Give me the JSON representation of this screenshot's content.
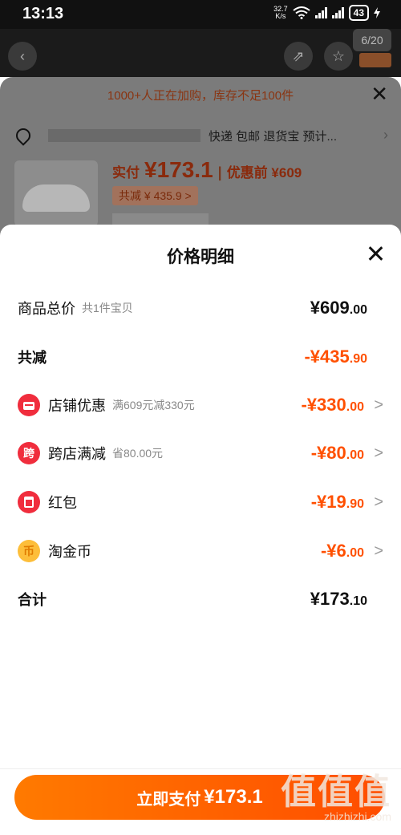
{
  "status_bar": {
    "time": "13:13",
    "net_speed_top": "32.7",
    "net_speed_bottom": "K/s",
    "battery": "43"
  },
  "background": {
    "page_count": "6/20",
    "banner": "1000+人正在加购，库存不足100件",
    "address_suffix": "快递 包邮 退货宝 预计...",
    "price_label": "实付",
    "price": "¥173.1",
    "price_sep": "|",
    "price_before": "优惠前 ¥609",
    "reduce_tag": "共减 ¥ 435.9 >"
  },
  "sheet": {
    "title": "价格明细",
    "rows": [
      {
        "label": "商品总价",
        "sub": "共1件宝贝",
        "amount_main": "¥609",
        "amount_dec": ".00"
      },
      {
        "label": "共减",
        "amount_main": "-¥435",
        "amount_dec": ".90"
      },
      {
        "label": "店铺优惠",
        "sub": "满609元减330元",
        "amount_main": "-¥330",
        "amount_dec": ".00",
        "icon_text": ""
      },
      {
        "label": "跨店满减",
        "sub": "省80.00元",
        "amount_main": "-¥80",
        "amount_dec": ".00",
        "icon_text": "跨"
      },
      {
        "label": "红包",
        "amount_main": "-¥19",
        "amount_dec": ".90",
        "icon_text": ""
      },
      {
        "label": "淘金币",
        "amount_main": "-¥6",
        "amount_dec": ".00",
        "icon_text": "币"
      },
      {
        "label": "合计",
        "amount_main": "¥173",
        "amount_dec": ".10"
      }
    ],
    "arrow": ">"
  },
  "bottom": {
    "pay_label": "立即支付",
    "pay_amount": "¥173.1"
  },
  "watermark": {
    "big": "值值值",
    "small": "zhizhizhi.com"
  },
  "colors": {
    "accent": "#ff5000",
    "icon_red": "#f02d3d",
    "icon_gold": "#fdbe3a"
  }
}
